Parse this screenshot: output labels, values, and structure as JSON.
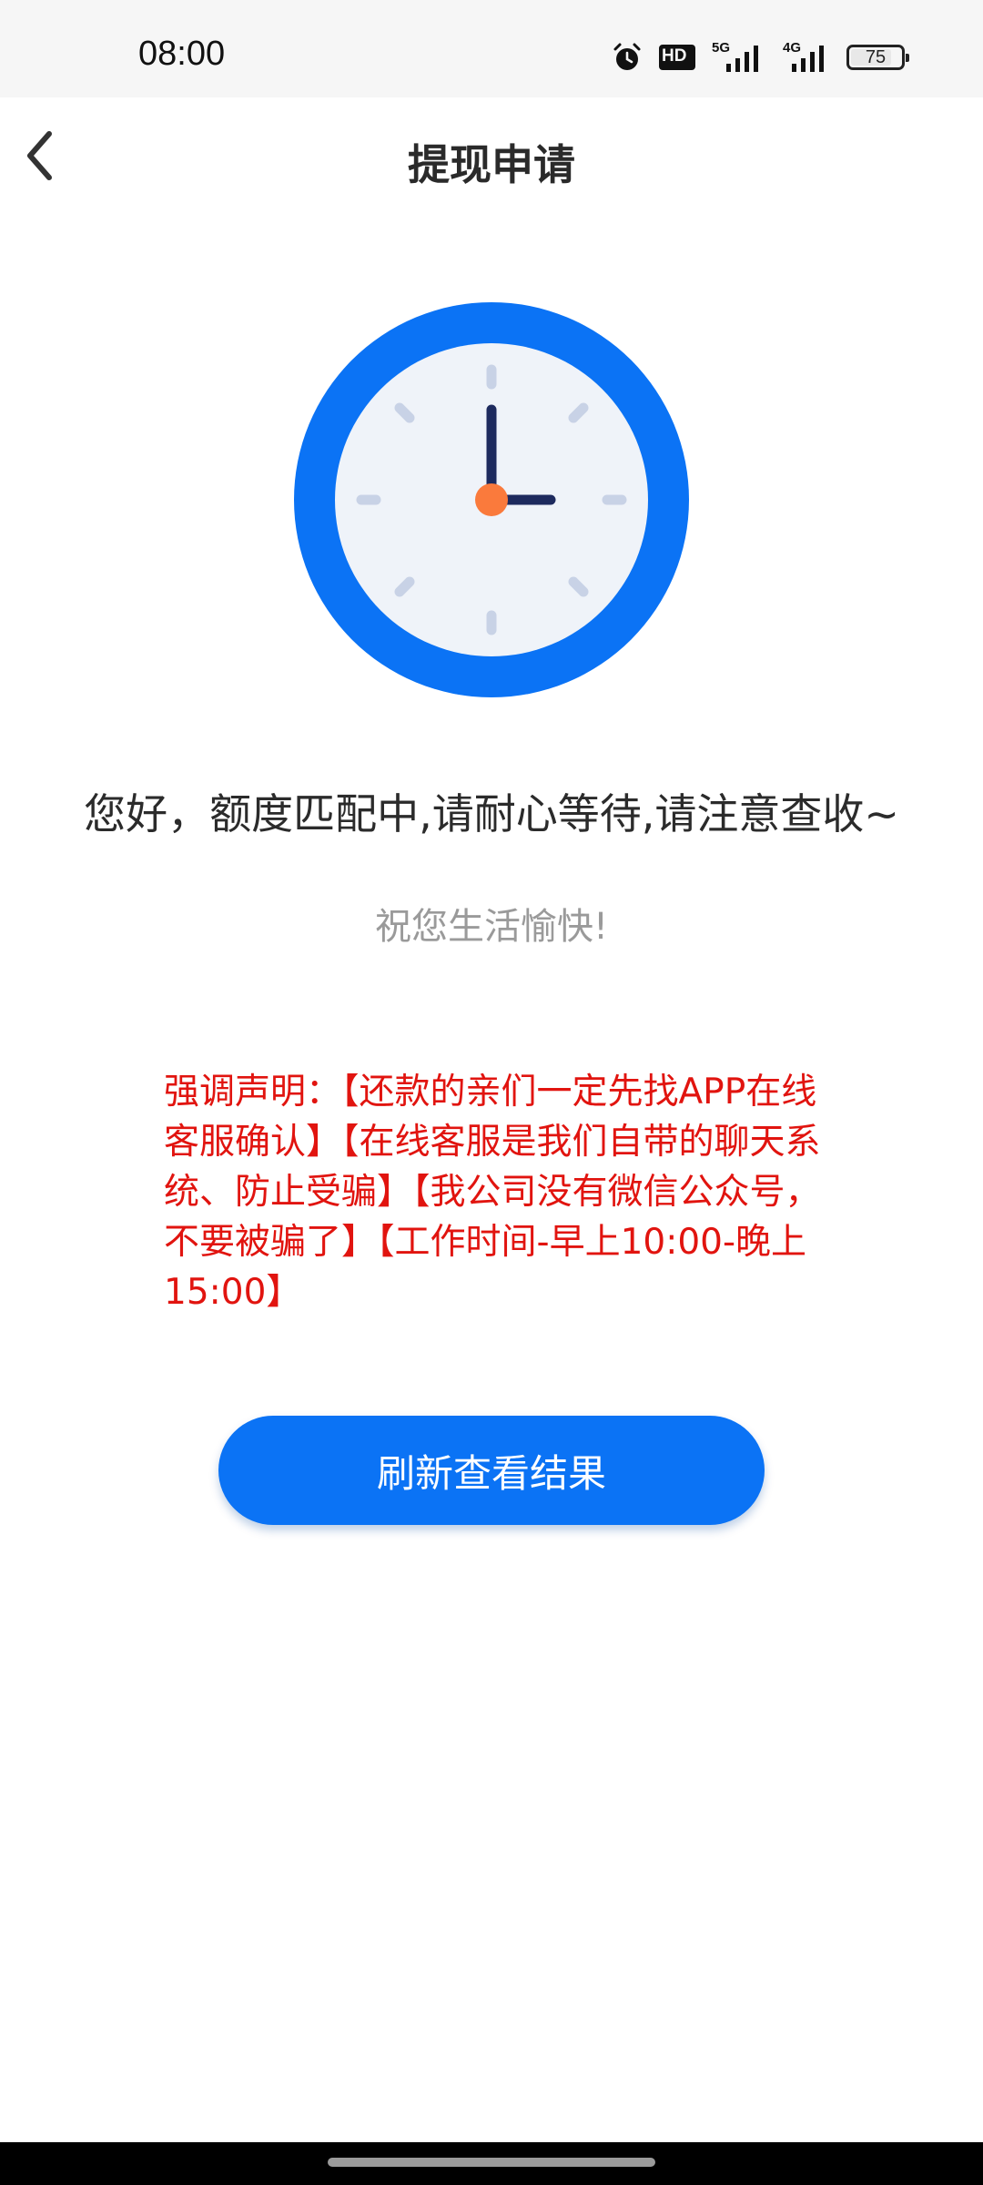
{
  "status_bar": {
    "time": "08:00",
    "icons": [
      "alarm-icon",
      "hd-icon",
      "5g-signal-icon",
      "4g-signal-icon",
      "battery-icon"
    ],
    "hd_label": "HD",
    "signal_5g_label": "5G",
    "signal_4g_label": "4G",
    "battery_level": "75"
  },
  "header": {
    "title": "提现申请",
    "back_icon": "chevron-left-icon"
  },
  "illustration": {
    "icon": "clock-icon",
    "colors": {
      "ring": "#0b73f5",
      "face": "#eff3f9",
      "hands": "#1d2a5e",
      "center": "#fa7a3c",
      "ticks": "#c8d2e6"
    }
  },
  "main": {
    "status_message": "您好，额度匹配中,请耐心等待,请注意查收~",
    "wish_message": "祝您生活愉快!",
    "notice": "强调声明：【还款的亲们一定先找APP在线客服确认】【在线客服是我们自带的聊天系统、防止受骗】【我公司没有微信公众号，不要被骗了】【工作时间-早上10:00-晚上15:00】",
    "refresh_button_label": "刷新查看结果"
  },
  "colors": {
    "accent": "#0b73f5",
    "notice_text": "#e1140f"
  }
}
